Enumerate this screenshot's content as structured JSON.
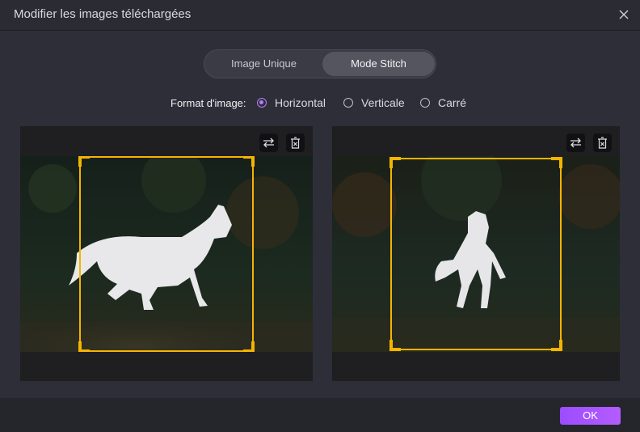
{
  "window": {
    "title": "Modifier les images téléchargées"
  },
  "mode_toggle": {
    "options": [
      {
        "label": "Image Unique",
        "selected": false
      },
      {
        "label": "Mode Stitch",
        "selected": true
      }
    ]
  },
  "format": {
    "label": "Format d'image:",
    "options": [
      {
        "label": "Horizontal",
        "selected": true
      },
      {
        "label": "Verticale",
        "selected": false
      },
      {
        "label": "Carré",
        "selected": false
      }
    ]
  },
  "images": [
    {
      "subject": "white horse galloping left-to-right in dark forest"
    },
    {
      "subject": "white horse rearing forward in dark forest"
    }
  ],
  "footer": {
    "ok_label": "OK"
  },
  "colors": {
    "accent": "#b57cff",
    "crop_frame": "#f5b400",
    "ok_button": "#a050ff"
  },
  "icons": [
    "close-icon",
    "swap-icon",
    "delete-icon"
  ]
}
